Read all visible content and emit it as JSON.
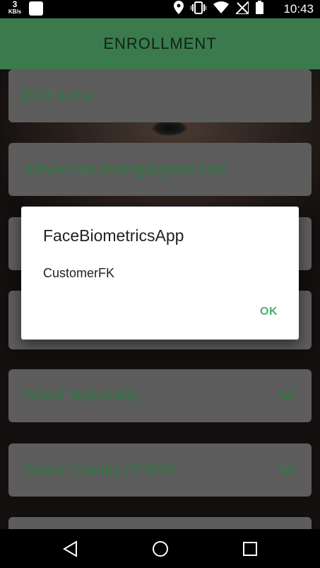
{
  "status_bar": {
    "net_speed_value": "3",
    "net_speed_unit": "KB/s",
    "time": "10:43",
    "icons": [
      "notification-icon",
      "location-icon",
      "vibrate-icon",
      "wifi-icon",
      "no-signal-icon",
      "battery-icon"
    ]
  },
  "app_bar": {
    "title": "ENROLLMENT"
  },
  "form": {
    "full_name_placeholder": "Full Name",
    "email_value": "rubyonrails.testing@gmail.com",
    "nationality_placeholder": "Select Nationality",
    "country_of_birth_placeholder": "Select Country Of Birth"
  },
  "dialog": {
    "title": "FaceBiometricsApp",
    "message": "CustomerFK",
    "ok_label": "OK"
  },
  "nav_bar": {
    "buttons": [
      "back-icon",
      "home-icon",
      "recents-icon"
    ]
  },
  "colors": {
    "app_bar": "#3a7a4d",
    "accent_green": "#4caf70",
    "field_bg": "#5d5d5d",
    "field_text": "#2f7a44"
  }
}
